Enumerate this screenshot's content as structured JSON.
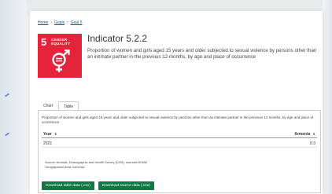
{
  "breadcrumb": [
    "Home",
    "Goals",
    "Goal 5"
  ],
  "goal": {
    "number": "5",
    "name_line1": "GENDER",
    "name_line2": "EQUALITY",
    "color": "#e5243b"
  },
  "indicator": {
    "title": "Indicator 5.2.2",
    "description": "Proportion of women and girls aged 15 years and older subjected to sexual violence by persons other than an intimate partner in the previous 12 months, by age and place of occurrence"
  },
  "tabs": [
    {
      "label": "Chart",
      "active": false
    },
    {
      "label": "Table",
      "active": true
    }
  ],
  "table": {
    "caption": "Proportion of women and girls aged 15 years and older subjected to sexual violence by persons other than an intimate partner in the previous 12 months, by age and place of occurrence",
    "columns": [
      "Year",
      "Armenia"
    ],
    "sort_glyph": "⇳",
    "rows": [
      [
        "2021",
        "0.3"
      ]
    ]
  },
  "source": {
    "line1": "Source: Armstat, Demographic and Health Survey (DHS), sources:DHAW",
    "line2": "Geographical Area: Armenia"
  },
  "buttons": {
    "download_table": "Download table data (.csv)",
    "download_source": "Download source data (.csv)",
    "color": "#0e7a3f"
  }
}
